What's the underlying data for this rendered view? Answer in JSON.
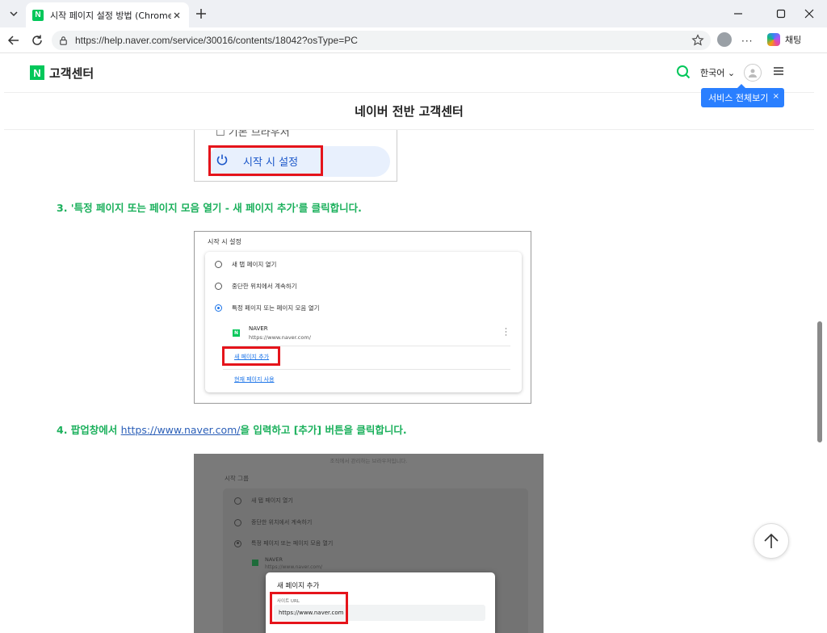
{
  "browser": {
    "tab_title": "시작 페이지 설정 방법 (Chrome) : 네이버 고객센터",
    "tab_favicon_letter": "N",
    "url": "https://help.naver.com/service/30016/contents/18042?osType=PC",
    "copilot_label": "채팅"
  },
  "site": {
    "logo_letter": "N",
    "name": "고객센터",
    "language": "한국어",
    "tooltip": "서비스 전체보기",
    "page_title": "네이버 전반 고객센터"
  },
  "shot1": {
    "prev_item": "기본 브라우저",
    "item": "시작 시 설정"
  },
  "steps": {
    "step3": "3. '특정 페이지 또는 페이지 모음 열기 - 새 페이지 추가'를 클릭합니다.",
    "step4_prefix": "4. 팝업창에서 ",
    "step4_link": "https://www.naver.com/",
    "step4_suffix": "을 입력하고 [추가] 버튼을 클릭합니다."
  },
  "shot2": {
    "title": "시작 시 설정",
    "options": [
      "새 탭 페이지 열기",
      "중단한 위치에서 계속하기",
      "특정 페이지 또는 페이지 모음 열기"
    ],
    "site_name": "NAVER",
    "site_url": "https://www.naver.com/",
    "add_link": "새 페이지 추가",
    "current_link": "현재 페이지 사용"
  },
  "shot3": {
    "notice": "조직에서 관리하는 브라우저입니다.",
    "title": "시작 그룹",
    "options": [
      "새 탭 페이지 열기",
      "중단한 위치에서 계속하기",
      "특정 페이지 또는 페이지 모음 열기"
    ],
    "site_name": "NAVER",
    "site_url": "https://www.naver.com/",
    "dialog_title": "새 페이지 추가",
    "field_label": "사이트 URL",
    "field_value": "https://www.naver.com"
  }
}
